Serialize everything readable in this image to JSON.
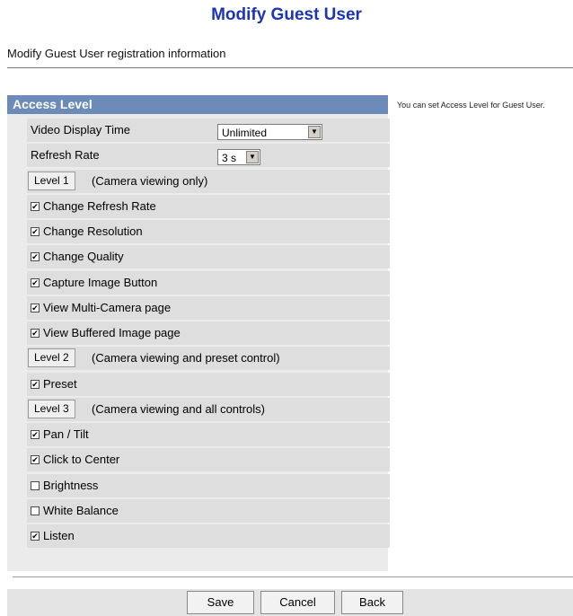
{
  "header": {
    "title": "Modify Guest User",
    "subtitle": "Modify Guest User registration information"
  },
  "panel": {
    "heading": "Access Level",
    "hint": "You can set Access Level for Guest User."
  },
  "settings": {
    "video_display_time": {
      "label": "Video Display Time",
      "value": "Unlimited"
    },
    "refresh_rate": {
      "label": "Refresh Rate",
      "value": "3 s"
    }
  },
  "levels": [
    {
      "button": "Level 1",
      "note": "(Camera viewing only)"
    },
    {
      "button": "Level 2",
      "note": "(Camera viewing and preset control)"
    },
    {
      "button": "Level 3",
      "note": "(Camera viewing and all controls)"
    }
  ],
  "permissions": [
    {
      "label": "Change Refresh Rate",
      "checked": true
    },
    {
      "label": "Change Resolution",
      "checked": true
    },
    {
      "label": "Change Quality",
      "checked": true
    },
    {
      "label": "Capture Image Button",
      "checked": true
    },
    {
      "label": "View Multi-Camera page",
      "checked": true
    },
    {
      "label": "View Buffered Image page",
      "checked": true
    },
    {
      "label": "Preset",
      "checked": true
    },
    {
      "label": "Pan / Tilt",
      "checked": true
    },
    {
      "label": "Click to Center",
      "checked": true
    },
    {
      "label": "Brightness",
      "checked": false
    },
    {
      "label": "White Balance",
      "checked": false
    },
    {
      "label": "Listen",
      "checked": true
    }
  ],
  "footer": {
    "save": "Save",
    "cancel": "Cancel",
    "back": "Back"
  },
  "colors": {
    "title": "#1d35b5",
    "panel_header": "#6c8bb8",
    "row_bg": "#dedede"
  }
}
